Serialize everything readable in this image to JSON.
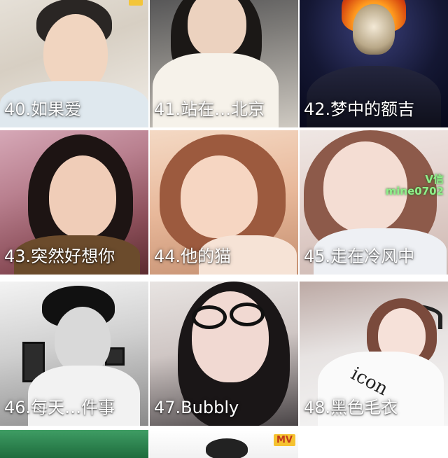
{
  "tiles": [
    {
      "caption": "40.如果爱"
    },
    {
      "caption": "41.站在…北京"
    },
    {
      "caption": "42.梦中的额吉"
    },
    {
      "caption": "43.突然好想你"
    },
    {
      "caption": "44.他的猫"
    },
    {
      "caption": "45.走在冷风中"
    },
    {
      "caption": "46.每天…件事"
    },
    {
      "caption": "47.Bubbly"
    },
    {
      "caption": "48.黑色毛衣"
    }
  ],
  "overlays": {
    "wechat_badge_line1": "V信",
    "wechat_badge_line2": "mine0702",
    "shirt_text": "icon",
    "mv_badge": "MV"
  }
}
